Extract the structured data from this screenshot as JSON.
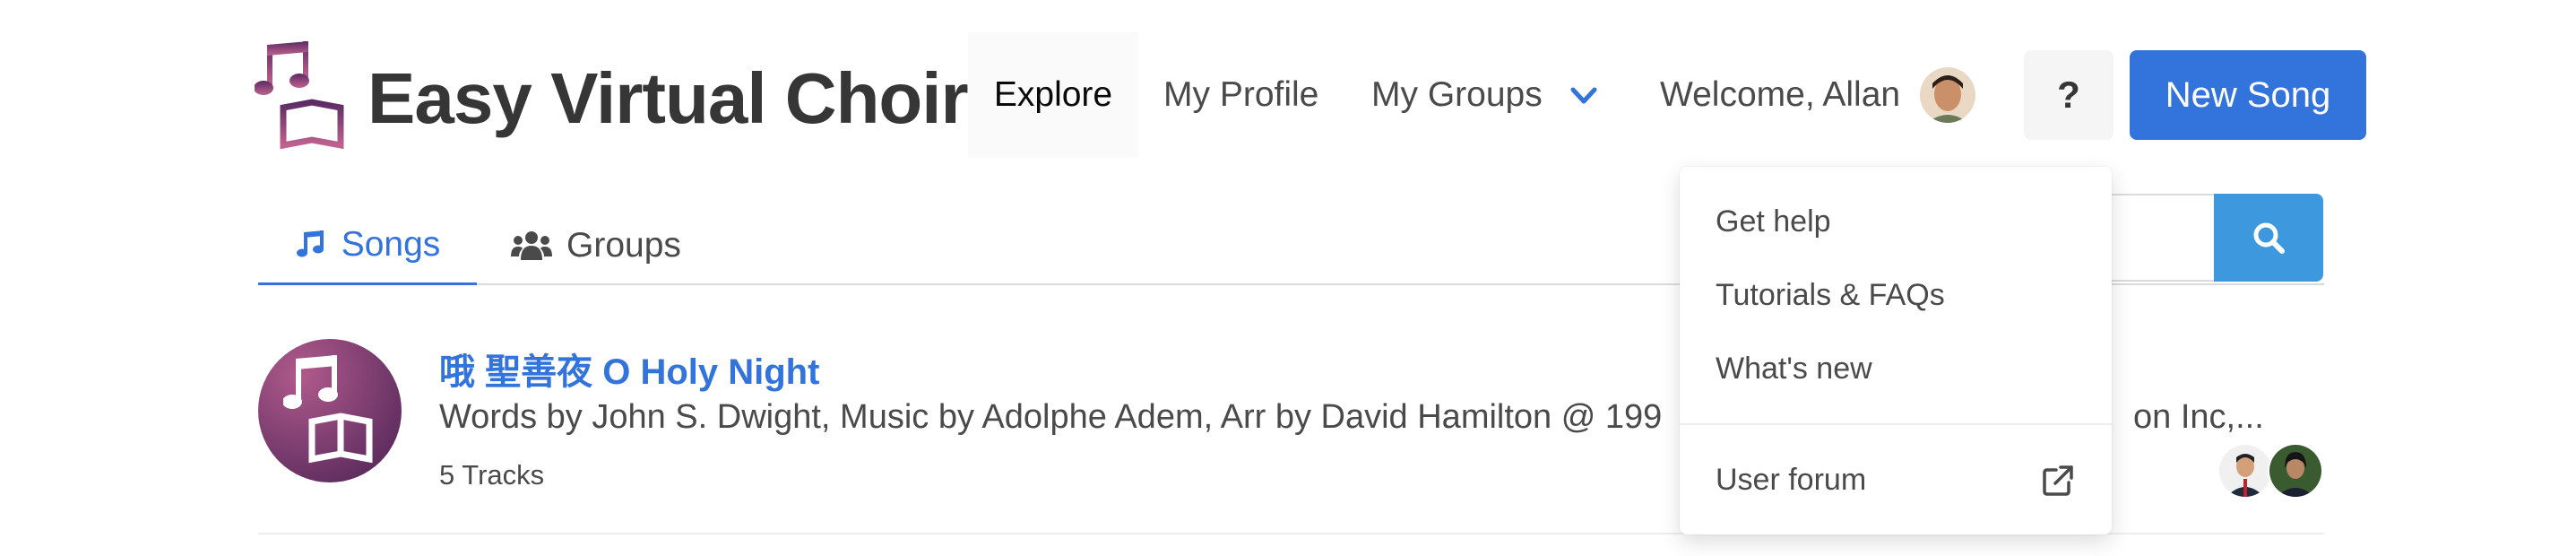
{
  "header": {
    "brand": "Easy Virtual Choir",
    "nav": {
      "explore": "Explore",
      "my_profile": "My Profile",
      "my_groups": "My Groups",
      "welcome": "Welcome, Allan"
    },
    "help_label": "?",
    "new_song_label": "New Song"
  },
  "tabs": {
    "songs": "Songs",
    "groups": "Groups"
  },
  "search": {
    "placeholder": ""
  },
  "songs": [
    {
      "title": "哦 聖善夜 O Holy Night",
      "description": "Words by John S. Dwight, Music by Adolphe Adem, Arr by David Hamilton @ 199",
      "description_tail": "on Inc,...",
      "tracks": "5 Tracks"
    }
  ],
  "help_menu": {
    "items": [
      "Get help",
      "Tutorials & FAQs",
      "What's new"
    ],
    "forum": "User forum"
  },
  "colors": {
    "primary": "#3273dc",
    "search": "#3e98de",
    "brand_purple": "#7b3f7a"
  }
}
